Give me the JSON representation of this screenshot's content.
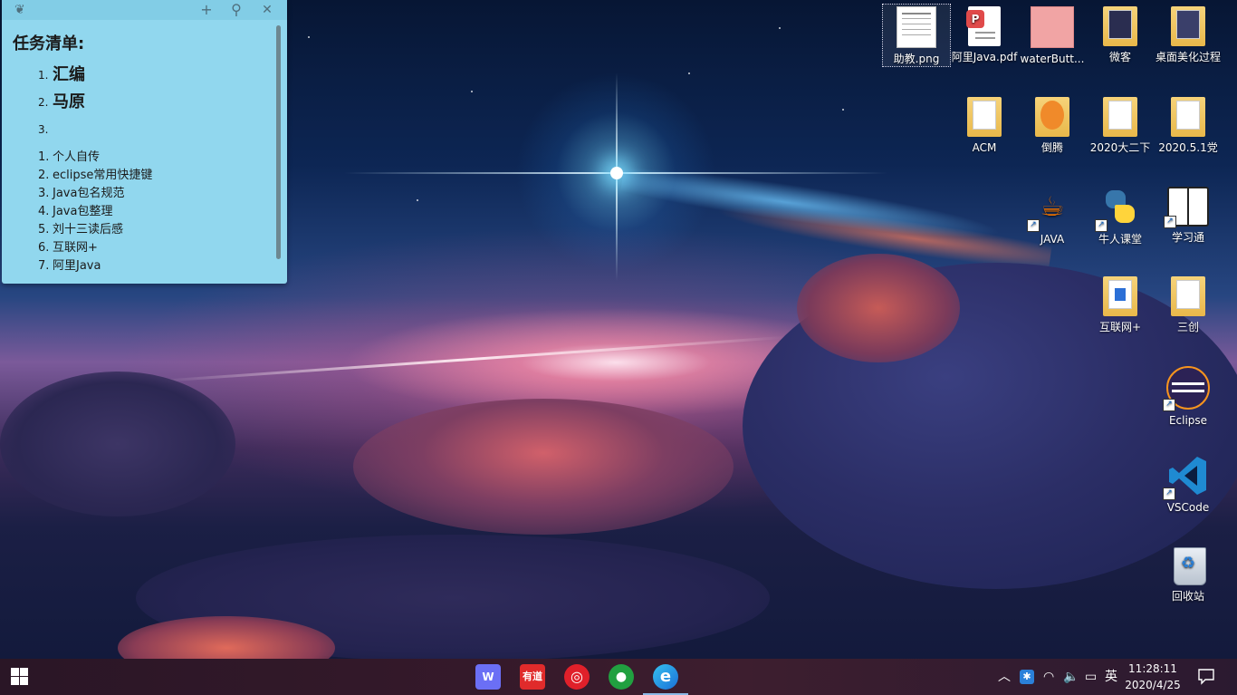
{
  "sticky_note": {
    "title": "任务清单:",
    "big_items": [
      {
        "num": "1.",
        "label": "汇编"
      },
      {
        "num": "2.",
        "label": "马原"
      },
      {
        "num": "3.",
        "label": ""
      }
    ],
    "items": [
      {
        "num": "1.",
        "label": "个人自传"
      },
      {
        "num": "2.",
        "label": "eclipse常用快捷键"
      },
      {
        "num": "3.",
        "label": "Java包名规范"
      },
      {
        "num": "4.",
        "label": "Java包整理"
      },
      {
        "num": "5.",
        "label": "刘十三读后感"
      },
      {
        "num": "6.",
        "label": "互联网+"
      },
      {
        "num": "7.",
        "label": "阿里Java"
      }
    ],
    "buttons": {
      "add": "+",
      "pin": "⚲",
      "close": "✕"
    },
    "color": "#91d7ee"
  },
  "desktop_icons": [
    {
      "label": "助教.png",
      "icon": "image-file-icon"
    },
    {
      "label": "阿里Java.pdf",
      "icon": "pdf-file-icon"
    },
    {
      "label": "waterButt...",
      "icon": "image-file-icon"
    },
    {
      "label": "微客",
      "icon": "folder-icon"
    },
    {
      "label": "桌面美化过程",
      "icon": "folder-icon"
    },
    {
      "label": "ACM",
      "icon": "folder-icon"
    },
    {
      "label": "倒腾",
      "icon": "folder-icon"
    },
    {
      "label": "2020大二下",
      "icon": "folder-icon"
    },
    {
      "label": "2020.5.1党",
      "icon": "folder-icon"
    },
    {
      "label": "JAVA",
      "icon": "java-icon"
    },
    {
      "label": "牛人课堂",
      "icon": "python-icon"
    },
    {
      "label": "学习通",
      "icon": "book-icon"
    },
    {
      "label": "互联网+",
      "icon": "folder-icon"
    },
    {
      "label": "三创",
      "icon": "folder-icon"
    },
    {
      "label": "Eclipse",
      "icon": "eclipse-icon"
    },
    {
      "label": "VSCode",
      "icon": "vscode-icon"
    },
    {
      "label": "回收站",
      "icon": "recycle-bin-icon"
    }
  ],
  "taskbar": {
    "apps": [
      {
        "name": "wps-icon",
        "glyph": "W",
        "color": "#6b6ff5"
      },
      {
        "name": "youdao-icon",
        "glyph": "有道",
        "color": "#e02b2b"
      },
      {
        "name": "netease-music-icon",
        "glyph": "◎",
        "color": "#e0202a"
      },
      {
        "name": "evernote-icon",
        "glyph": "●",
        "color": "#21a040"
      },
      {
        "name": "edge-icon",
        "glyph": "e",
        "color": "#1b8fd6"
      }
    ],
    "tray": {
      "ime": "英",
      "time": "11:28:11",
      "date": "2020/4/25"
    }
  }
}
